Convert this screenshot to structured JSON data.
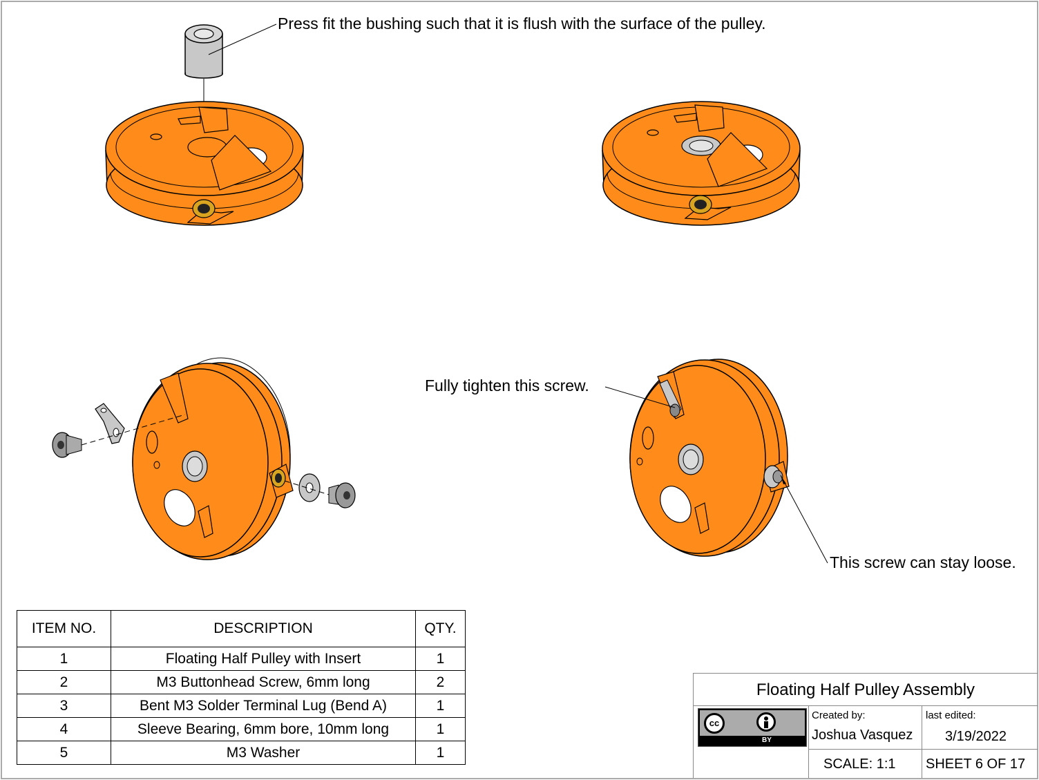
{
  "notes": {
    "bushing": "Press fit the bushing such that it is flush with the surface of the pulley.",
    "tighten": "Fully tighten this screw.",
    "loose": "This screw can stay loose."
  },
  "bom": {
    "headers": [
      "ITEM NO.",
      "DESCRIPTION",
      "QTY."
    ],
    "rows": [
      [
        "1",
        "Floating Half Pulley with Insert",
        "1"
      ],
      [
        "2",
        "M3 Buttonhead Screw, 6mm long",
        "2"
      ],
      [
        "3",
        "Bent M3 Solder Terminal Lug (Bend A)",
        "1"
      ],
      [
        "4",
        "Sleeve Bearing, 6mm bore, 10mm long",
        "1"
      ],
      [
        "5",
        "M3 Washer",
        "1"
      ]
    ]
  },
  "title_block": {
    "title": "Floating Half Pulley Assembly",
    "created_by_label": "Created by:",
    "created_by": "Joshua Vasquez",
    "last_edited_label": "last edited:",
    "last_edited": "3/19/2022",
    "scale": "SCALE: 1:1",
    "sheet": "SHEET 6 OF 17",
    "license_logo": {
      "cc": "cc",
      "by": "BY"
    }
  },
  "colors": {
    "part_orange": "#ff8c1a",
    "hardware_gray": "#c8c8c8",
    "insert_brass": "#d9a520",
    "border": "#aaaaaa"
  }
}
